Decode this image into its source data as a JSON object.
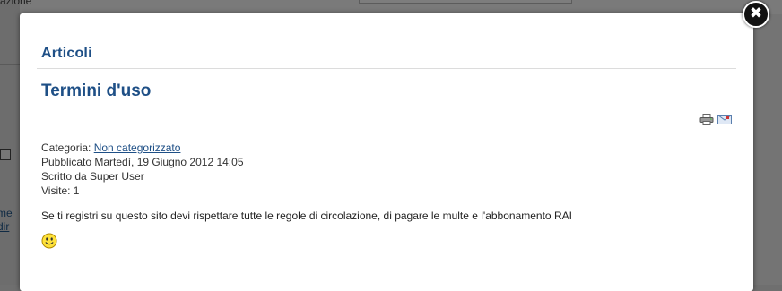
{
  "background": {
    "fragment_text": "zrazione",
    "link_1": "me",
    "link_2": "dir"
  },
  "modal": {
    "close_symbol": "✖",
    "section_title": "Articoli",
    "article": {
      "title": "Termini d'uso",
      "category_label": "Categoria: ",
      "category_link": "Non categorizzato",
      "published": "Pubblicato Martedì, 19 Giugno 2012 14:05",
      "author": "Scritto da Super User",
      "hits": "Visite: 1",
      "body": "Se ti registri su questo sito devi rispettare tutte le regole di circolazione, di pagare le multe e l'abbonamento RAI"
    },
    "icons": [
      "print-icon",
      "email-icon",
      "smiley-icon"
    ]
  },
  "colors": {
    "accent": "#1e4f86",
    "overlay": "#747474",
    "modal_bg": "#ffffff"
  }
}
